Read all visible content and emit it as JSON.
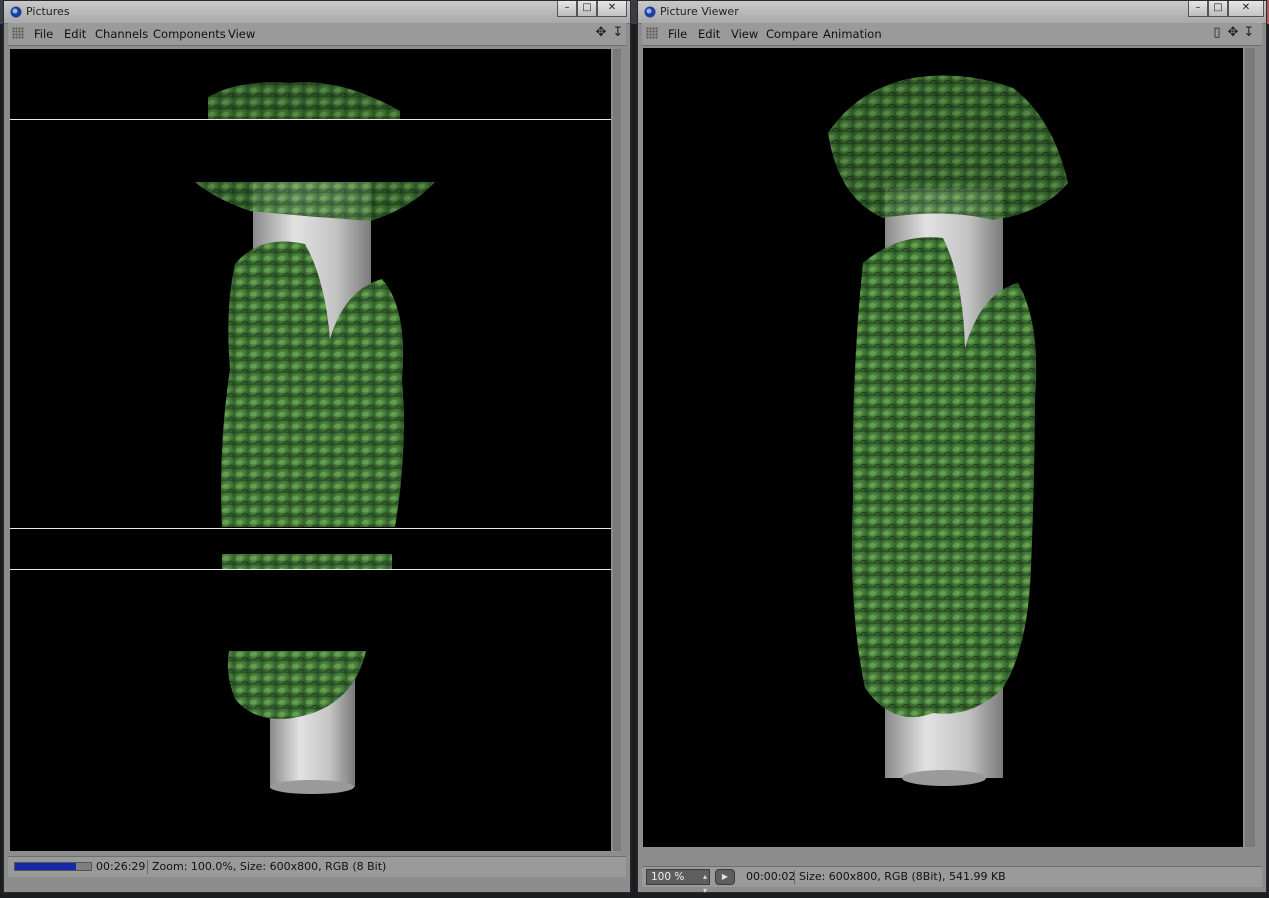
{
  "left_window": {
    "title": "Pictures",
    "controls": {
      "minimize": "–",
      "maximize": "□",
      "close": "✕"
    },
    "menu": [
      "File",
      "Edit",
      "Channels",
      "Components",
      "View"
    ],
    "toolbar_icons": [
      "move-icon",
      "down-arrow-icon"
    ],
    "status": {
      "progress": 0.8,
      "time": "00:26:29",
      "info": "Zoom: 100.0%, Size: 600x800, RGB (8 Bit)"
    }
  },
  "right_window": {
    "title": "Picture Viewer",
    "controls": {
      "minimize": "–",
      "maximize": "□",
      "close": "✕"
    },
    "menu": [
      "File",
      "Edit",
      "View",
      "Compare",
      "Animation"
    ],
    "toolbar_icons": [
      "window-icon",
      "move-icon",
      "down-arrow-icon"
    ],
    "status": {
      "zoom": "100 %",
      "time": "00:00:02",
      "info": "Size: 600x800, RGB (8Bit), 541.99 KB"
    }
  },
  "colors": {
    "chrome": "#8d8d8d",
    "viewport_bg": "#000000",
    "progress_fill": "#1629a8",
    "foliage_dark": "#24461f",
    "foliage_light": "#5d9a48",
    "column": "#c8c8c8"
  }
}
